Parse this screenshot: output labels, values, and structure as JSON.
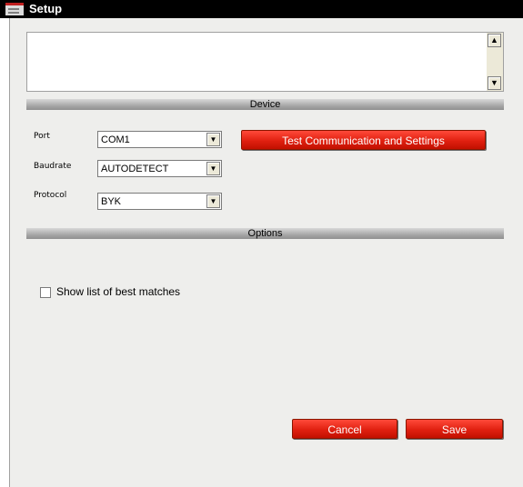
{
  "window": {
    "title": "Setup",
    "app_icon": "app-logo-icon"
  },
  "log": {
    "scroll_up": "▲",
    "scroll_down": "▼"
  },
  "sections": {
    "device": "Device",
    "options": "Options"
  },
  "device": {
    "port_label": "Port",
    "port_value": "COM1",
    "baudrate_label": "Baudrate",
    "baudrate_value": "AUTODETECT",
    "protocol_label": "Protocol",
    "protocol_value": "BYK",
    "dropdown_arrow": "▼",
    "test_button": "Test Communication and Settings"
  },
  "options": {
    "show_best_matches_label": "Show list of best matches",
    "show_best_matches_checked": false
  },
  "footer": {
    "cancel_label": "Cancel",
    "save_label": "Save"
  },
  "colors": {
    "accent_button": "#e02010",
    "section_bar": "#a8a8a8",
    "titlebar": "#000000"
  }
}
